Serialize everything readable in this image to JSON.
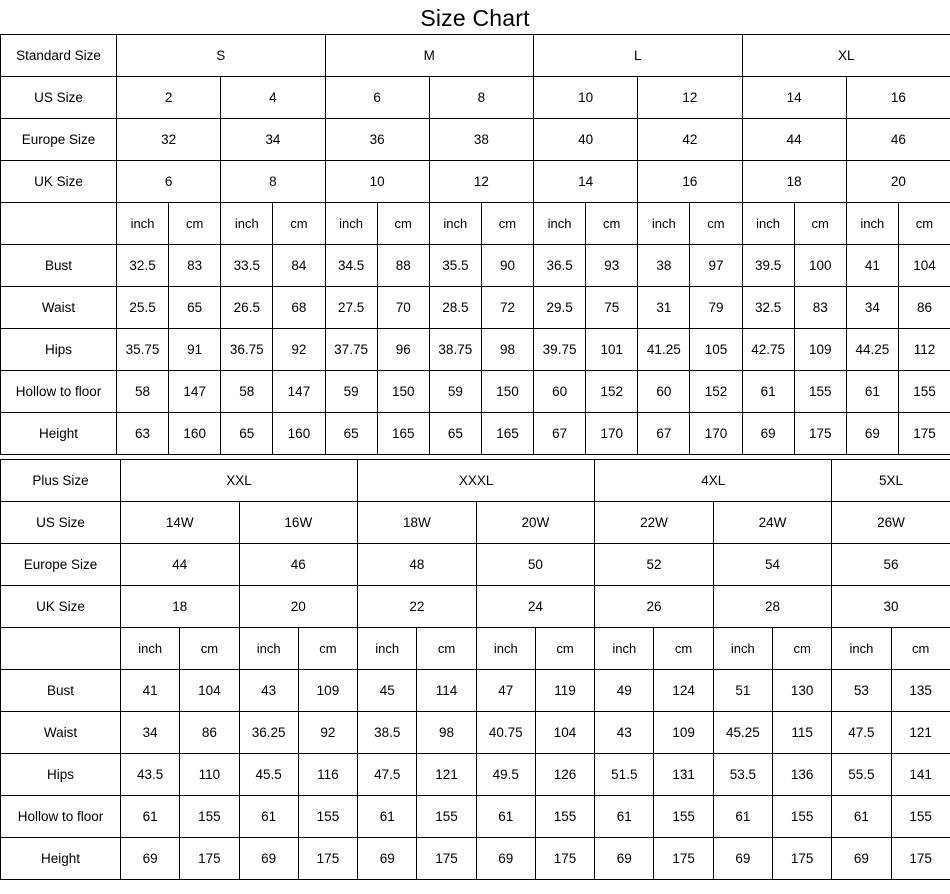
{
  "title": "Size Chart",
  "units": {
    "inch": "inch",
    "cm": "cm"
  },
  "standard": {
    "label_row_group": "Standard Size",
    "label_row_us": "US Size",
    "label_row_eu": "Europe Size",
    "label_row_uk": "UK Size",
    "label_row_unit": "",
    "groups": [
      "S",
      "M",
      "L",
      "XL"
    ],
    "us_sizes": [
      "2",
      "4",
      "6",
      "8",
      "10",
      "12",
      "14",
      "16"
    ],
    "eu_sizes": [
      "32",
      "34",
      "36",
      "38",
      "40",
      "42",
      "44",
      "46"
    ],
    "uk_sizes": [
      "6",
      "8",
      "10",
      "12",
      "14",
      "16",
      "18",
      "20"
    ],
    "measurements": [
      {
        "name": "Bust",
        "inch": [
          "32.5",
          "33.5",
          "34.5",
          "35.5",
          "36.5",
          "38",
          "39.5",
          "41"
        ],
        "cm": [
          "83",
          "84",
          "88",
          "90",
          "93",
          "97",
          "100",
          "104"
        ]
      },
      {
        "name": "Waist",
        "inch": [
          "25.5",
          "26.5",
          "27.5",
          "28.5",
          "29.5",
          "31",
          "32.5",
          "34"
        ],
        "cm": [
          "65",
          "68",
          "70",
          "72",
          "75",
          "79",
          "83",
          "86"
        ]
      },
      {
        "name": "Hips",
        "inch": [
          "35.75",
          "36.75",
          "37.75",
          "38.75",
          "39.75",
          "41.25",
          "42.75",
          "44.25"
        ],
        "cm": [
          "91",
          "92",
          "96",
          "98",
          "101",
          "105",
          "109",
          "112"
        ]
      },
      {
        "name": "Hollow to floor",
        "inch": [
          "58",
          "58",
          "59",
          "59",
          "60",
          "60",
          "61",
          "61"
        ],
        "cm": [
          "147",
          "147",
          "150",
          "150",
          "152",
          "152",
          "155",
          "155"
        ]
      },
      {
        "name": "Height",
        "inch": [
          "63",
          "65",
          "65",
          "65",
          "67",
          "67",
          "69",
          "69"
        ],
        "cm": [
          "160",
          "160",
          "165",
          "165",
          "170",
          "170",
          "175",
          "175"
        ]
      }
    ]
  },
  "plus": {
    "label_row_group": "Plus Size",
    "label_row_us": "US  Size",
    "label_row_eu": "Europe Size",
    "label_row_uk": "UK Size",
    "label_row_unit": "",
    "groups": [
      {
        "label": "XXL",
        "span": 2
      },
      {
        "label": "XXXL",
        "span": 2
      },
      {
        "label": "4XL",
        "span": 2
      },
      {
        "label": "5XL",
        "span": 1
      }
    ],
    "us_sizes": [
      "14W",
      "16W",
      "18W",
      "20W",
      "22W",
      "24W",
      "26W"
    ],
    "eu_sizes": [
      "44",
      "46",
      "48",
      "50",
      "52",
      "54",
      "56"
    ],
    "uk_sizes": [
      "18",
      "20",
      "22",
      "24",
      "26",
      "28",
      "30"
    ],
    "measurements": [
      {
        "name": "Bust",
        "inch": [
          "41",
          "43",
          "45",
          "47",
          "49",
          "51",
          "53"
        ],
        "cm": [
          "104",
          "109",
          "114",
          "119",
          "124",
          "130",
          "135"
        ]
      },
      {
        "name": "Waist",
        "inch": [
          "34",
          "36.25",
          "38.5",
          "40.75",
          "43",
          "45.25",
          "47.5"
        ],
        "cm": [
          "86",
          "92",
          "98",
          "104",
          "109",
          "115",
          "121"
        ]
      },
      {
        "name": "Hips",
        "inch": [
          "43.5",
          "45.5",
          "47.5",
          "49.5",
          "51.5",
          "53.5",
          "55.5"
        ],
        "cm": [
          "110",
          "116",
          "121",
          "126",
          "131",
          "136",
          "141"
        ]
      },
      {
        "name": "Hollow to floor",
        "inch": [
          "61",
          "61",
          "61",
          "61",
          "61",
          "61",
          "61"
        ],
        "cm": [
          "155",
          "155",
          "155",
          "155",
          "155",
          "155",
          "155"
        ]
      },
      {
        "name": "Height",
        "inch": [
          "69",
          "69",
          "69",
          "69",
          "69",
          "69",
          "69"
        ],
        "cm": [
          "175",
          "175",
          "175",
          "175",
          "175",
          "175",
          "175"
        ]
      }
    ]
  },
  "colors": {
    "gray": "#CCCCCC",
    "white": "#FFFFFF",
    "border": "#000000",
    "text": "#000000"
  }
}
